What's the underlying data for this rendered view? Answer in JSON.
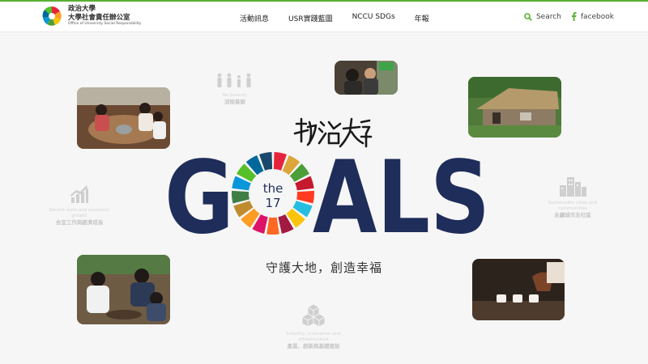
{
  "header": {
    "logo": {
      "line1": "政治大學",
      "line2": "大學社會責任辦公室",
      "line3": "Office of University Social Responsibility"
    },
    "nav": [
      "活動訊息",
      "USR實踐藍圖",
      "NCCU SDGs",
      "年報"
    ],
    "search_label": "Search",
    "facebook_label": "facebook"
  },
  "hero": {
    "calligraphy": "政治大學",
    "goals_word": "GOALS",
    "wheel_line1": "the",
    "wheel_line2": "17",
    "slogan": "守護大地，創造幸福"
  },
  "sdg_labels": [
    {
      "en": "No poverty",
      "zh": "消除貧窮",
      "icon": "people-icon"
    },
    {
      "en": "Decent work and economic growth",
      "zh": "合宜工作與經濟成長",
      "icon": "growth-chart-icon"
    },
    {
      "en": "Sustainable cities and communities",
      "zh": "永續城市及社區",
      "icon": "city-buildings-icon"
    },
    {
      "en": "Industry, innovation and infrastructure",
      "zh": "產業、創新與基礎建設",
      "icon": "cubes-icon"
    }
  ],
  "colors": {
    "accent_green": "#5ab031",
    "goals_navy": "#1f2d5a",
    "sdg_wheel": [
      "#e5243b",
      "#dda63a",
      "#4c9f38",
      "#c5192d",
      "#ff3a21",
      "#26bde2",
      "#fcc30b",
      "#a21942",
      "#fd6925",
      "#dd1367",
      "#fd9d24",
      "#bf8b2e",
      "#3f7e44",
      "#0a97d9",
      "#56c02b",
      "#00689d",
      "#19486a"
    ]
  }
}
